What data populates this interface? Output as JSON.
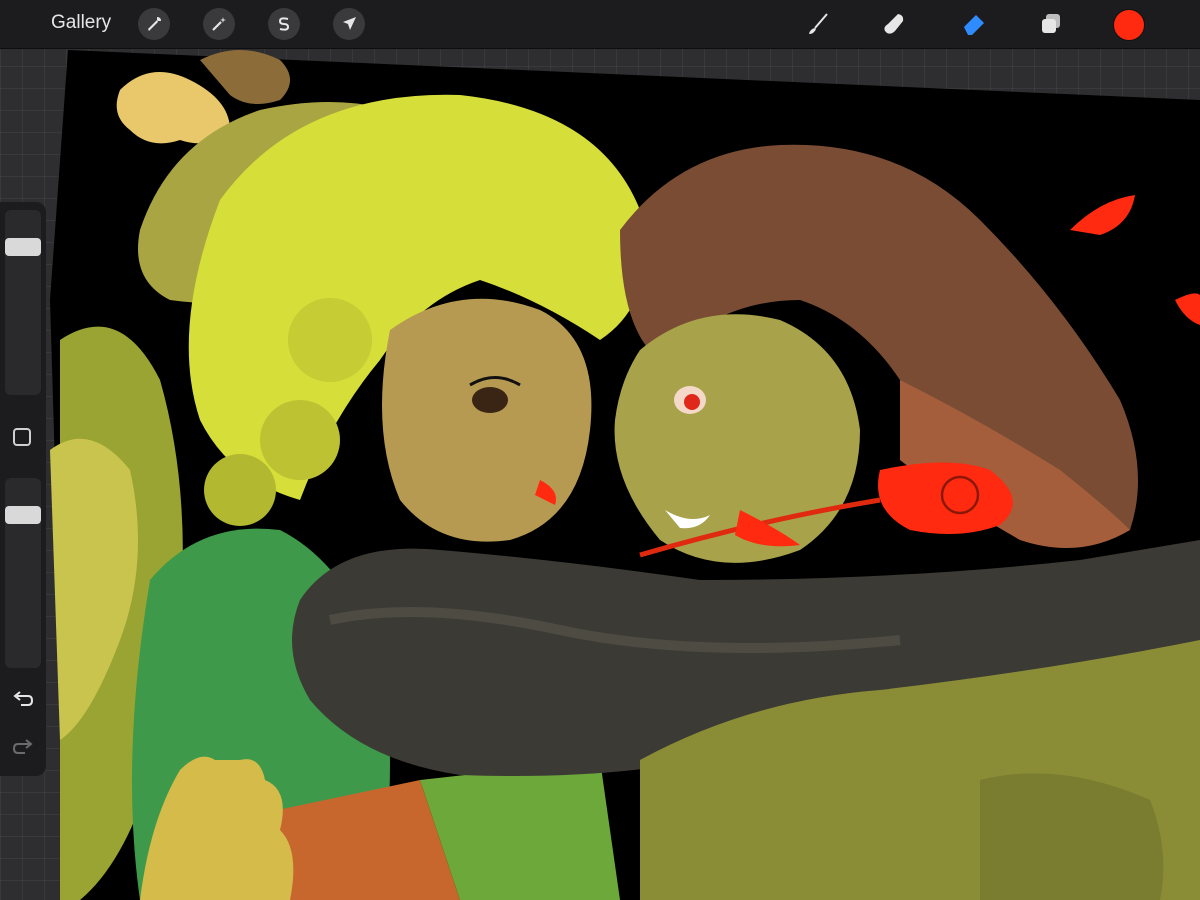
{
  "toolbar": {
    "gallery_label": "Gallery",
    "actions_icon": "wrench-icon",
    "adjustments_icon": "magic-wand-icon",
    "selection_icon": "selection-s-icon",
    "transform_icon": "arrow-cursor-icon",
    "brush_icon": "paintbrush-icon",
    "smudge_icon": "smudge-finger-icon",
    "eraser_icon": "eraser-icon",
    "layers_icon": "layers-icon",
    "active_tool": "eraser",
    "active_tool_color": "#2f8cff",
    "current_color": "#ff2a10"
  },
  "sidebar": {
    "brush_size_level": 0.05,
    "opacity_level": 0.05,
    "modify_icon": "square-outline-icon",
    "undo_icon": "undo-arrow-icon",
    "redo_icon": "redo-arrow-icon",
    "redo_enabled": false
  },
  "canvas": {
    "background": "#000000",
    "accent_red": "#ff2a10",
    "hair_yellow": "#c9d43a",
    "hair_brown": "#7a4c34",
    "jacket_dark": "#3c3a34",
    "sweater_green": "#3e9a4a"
  }
}
